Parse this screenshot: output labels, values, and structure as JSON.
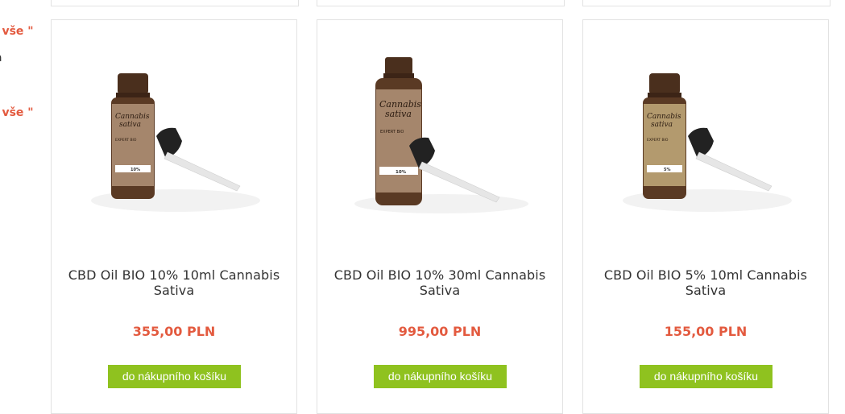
{
  "sidebar": {
    "links": [
      ": vše \"",
      ": vše \""
    ],
    "text_fragment": "a"
  },
  "products": [
    {
      "title": "CBD Oil BIO 10% 10ml Cannabis Sativa",
      "price": "355,00 PLN",
      "cart_label": "do nákupního košíku",
      "bottle_label": [
        "Cannabis",
        "sativa"
      ],
      "bottle_sub": "EXPERT BIO",
      "bottle_percent": "10%"
    },
    {
      "title": "CBD Oil BIO 10% 30ml Cannabis Sativa",
      "price": "995,00 PLN",
      "cart_label": "do nákupního košíku",
      "bottle_label": [
        "Cannabis",
        "sativa"
      ],
      "bottle_sub": "EXPERT BIO",
      "bottle_percent": "10%"
    },
    {
      "title": "CBD Oil BIO 5% 10ml Cannabis Sativa",
      "price": "155,00 PLN",
      "cart_label": "do nákupního košíku",
      "bottle_label": [
        "Cannabis",
        "sativa"
      ],
      "bottle_sub": "EXPERT BIO",
      "bottle_percent": "5%"
    }
  ],
  "colors": {
    "accent": "#e35a3f",
    "button": "#8fc21f",
    "border": "#e2e2e2",
    "bottle_glass": "#5a3a24",
    "bottle_label_bg": "#a5866c"
  }
}
